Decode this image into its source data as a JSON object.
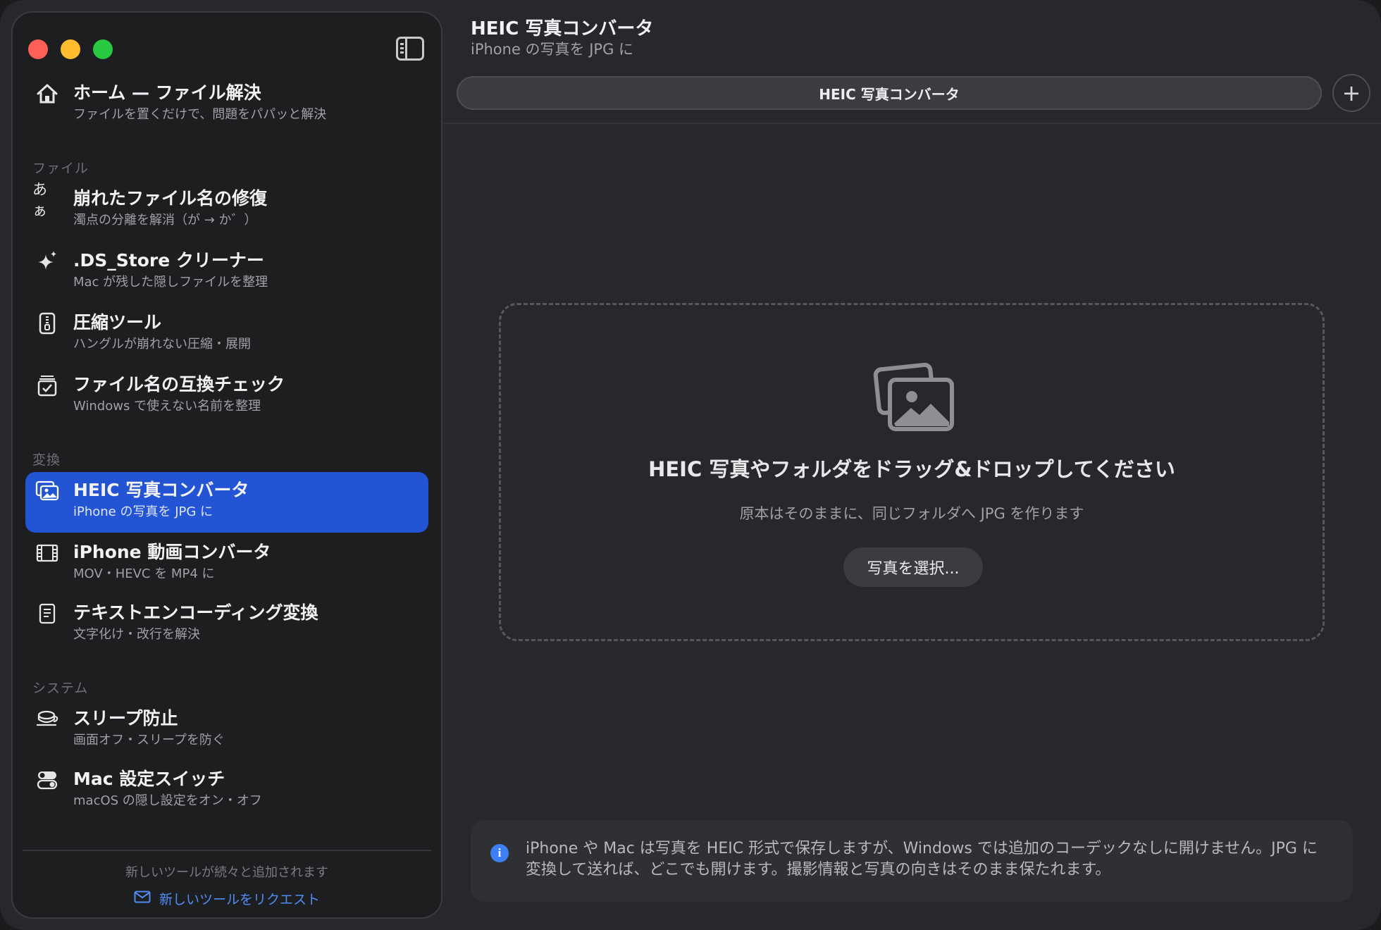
{
  "sidebar": {
    "home": {
      "title": "ホーム — ファイル解決",
      "subtitle": "ファイルを置くだけで、問題をパパッと解決",
      "icon": "house-icon"
    },
    "sections": [
      {
        "label": "ファイル"
      },
      {
        "label": "変換"
      },
      {
        "label": "システム"
      }
    ],
    "items": [
      {
        "title": "崩れたファイル名の修復",
        "subtitle": "濁点の分離を解消（が → か゛）",
        "icon": "あぁ"
      },
      {
        "title": ".DS_Store クリーナー",
        "subtitle": "Mac が残した隠しファイルを整理",
        "icon": "sparkles-icon"
      },
      {
        "title": "圧縮ツール",
        "subtitle": "ハングルが崩れない圧縮・展開",
        "icon": "zipper-icon"
      },
      {
        "title": "ファイル名の互換チェック",
        "subtitle": "Windows で使えない名前を整理",
        "icon": "checklist-icon"
      },
      {
        "title": "HEIC 写真コンバータ",
        "subtitle": "iPhone の写真を JPG に",
        "icon": "photos-icon",
        "active": true
      },
      {
        "title": "iPhone 動画コンバータ",
        "subtitle": "MOV・HEVC を MP4 に",
        "icon": "film-icon"
      },
      {
        "title": "テキストエンコーディング変換",
        "subtitle": "文字化け・改行を解決",
        "icon": "document-icon"
      },
      {
        "title": "スリープ防止",
        "subtitle": "画面オフ・スリープを防ぐ",
        "icon": "cup-icon"
      },
      {
        "title": "Mac 設定スイッチ",
        "subtitle": "macOS の隠し設定をオン・オフ",
        "icon": "switches-icon"
      }
    ],
    "footer_note": "新しいツールが続々と追加されます",
    "request_link": "新しいツールをリクエスト"
  },
  "main": {
    "title": "HEIC 写真コンバータ",
    "subtitle": "iPhone の写真を JPG に",
    "tab_label": "HEIC 写真コンバータ",
    "add_tab": "+",
    "drop_zone": {
      "title": "HEIC 写真やフォルダをドラッグ&ドロップしてください",
      "subtitle": "原本はそのままに、同じフォルダへ JPG を作ります",
      "button": "写真を選択..."
    },
    "info": {
      "icon": "i",
      "text": "iPhone や Mac は写真を HEIC 形式で保存しますが、Windows では追加のコーデックなしに開けません。JPG に変換して送れば、どこでも開けます。撮影情報と写真の向きはそのまま保たれます。"
    }
  },
  "colors": {
    "accent": "#2254d4",
    "link": "#4f8df6",
    "info": "#3d7ff5"
  }
}
